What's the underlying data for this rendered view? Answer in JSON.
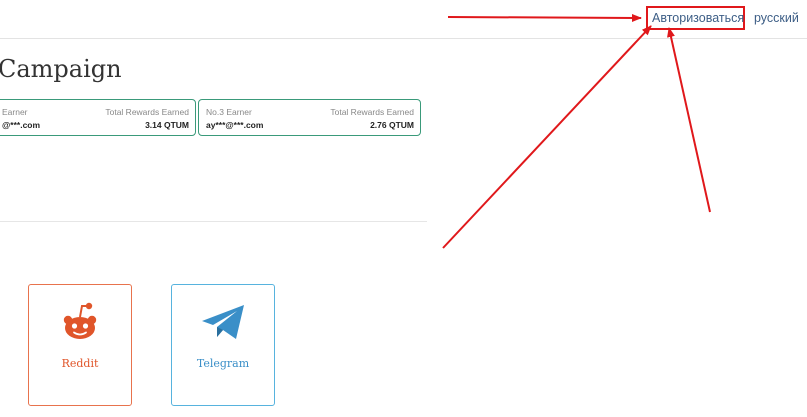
{
  "header": {
    "login_label": "Авторизоваться",
    "language_label": "русский"
  },
  "main": {
    "title": "Campaign",
    "top_earners": [
      {
        "rank_label": "Earner",
        "rewards_label": "Total Rewards Earned",
        "email": "@***.com",
        "amount": "3.14 QTUM"
      },
      {
        "rank_label": "No.3 Earner",
        "rewards_label": "Total Rewards Earned",
        "email": "ay***@***.com",
        "amount": "2.76 QTUM"
      }
    ],
    "social_tasks": [
      {
        "label": "Reddit",
        "icon": "reddit-icon"
      },
      {
        "label": "Telegram",
        "icon": "telegram-icon"
      }
    ]
  },
  "colors": {
    "link": "#3d5e86",
    "annotation_red": "#e0181b",
    "card_border": "#3a9a7a",
    "reddit": "#e0552a",
    "telegram": "#3a8fc8"
  }
}
